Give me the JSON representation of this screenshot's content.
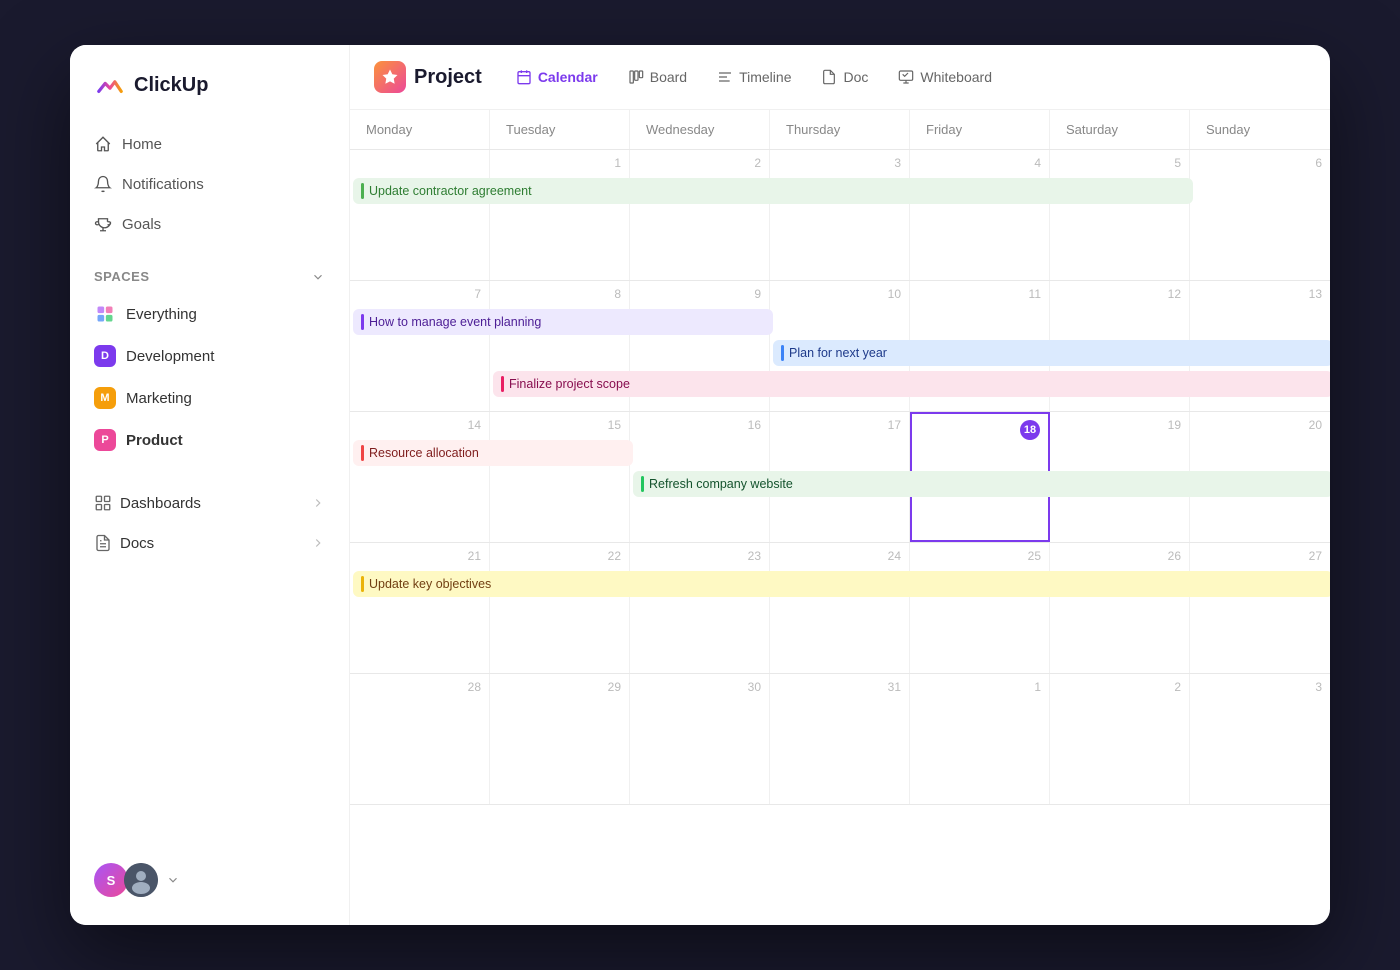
{
  "app": {
    "name": "ClickUp"
  },
  "sidebar": {
    "nav": [
      {
        "id": "home",
        "label": "Home",
        "icon": "home"
      },
      {
        "id": "notifications",
        "label": "Notifications",
        "icon": "bell"
      },
      {
        "id": "goals",
        "label": "Goals",
        "icon": "trophy"
      }
    ],
    "spaces_label": "Spaces",
    "spaces": [
      {
        "id": "everything",
        "label": "Everything",
        "type": "everything",
        "color": null
      },
      {
        "id": "development",
        "label": "Development",
        "type": "dot",
        "color": "#7c3aed",
        "initial": "D"
      },
      {
        "id": "marketing",
        "label": "Marketing",
        "type": "dot",
        "color": "#f59e0b",
        "initial": "M"
      },
      {
        "id": "product",
        "label": "Product",
        "type": "dot",
        "color": "#ec4899",
        "initial": "P",
        "active": true
      }
    ],
    "bottom": [
      {
        "id": "dashboards",
        "label": "Dashboards",
        "has_arrow": true
      },
      {
        "id": "docs",
        "label": "Docs",
        "has_arrow": true
      }
    ],
    "user": {
      "avatar_initial": "S",
      "chevron": "▾"
    }
  },
  "header": {
    "project_icon": "🎯",
    "project_title": "Project",
    "views": [
      {
        "id": "calendar",
        "label": "Calendar",
        "active": true,
        "icon": "calendar"
      },
      {
        "id": "board",
        "label": "Board",
        "active": false,
        "icon": "board"
      },
      {
        "id": "timeline",
        "label": "Timeline",
        "active": false,
        "icon": "timeline"
      },
      {
        "id": "doc",
        "label": "Doc",
        "active": false,
        "icon": "doc"
      },
      {
        "id": "whiteboard",
        "label": "Whiteboard",
        "active": false,
        "icon": "whiteboard"
      }
    ]
  },
  "calendar": {
    "day_headers": [
      "Monday",
      "Tuesday",
      "Wednesday",
      "Thursday",
      "Friday",
      "Saturday",
      "Sunday"
    ],
    "weeks": [
      {
        "cells": [
          {
            "date": "",
            "is_today": false
          },
          {
            "date": "1",
            "is_today": false
          },
          {
            "date": "2",
            "is_today": false
          },
          {
            "date": "3",
            "is_today": false
          },
          {
            "date": "4",
            "is_today": false
          },
          {
            "date": "5",
            "is_today": false
          },
          {
            "date": "6",
            "is_today": false
          }
        ],
        "events": [
          {
            "label": "Update contractor agreement",
            "col_start": 1,
            "col_span": 6,
            "bg": "#e8f5e9",
            "bar": "#4caf50",
            "text": "#2e7d32"
          }
        ]
      },
      {
        "cells": [
          {
            "date": "7",
            "is_today": false
          },
          {
            "date": "8",
            "is_today": false
          },
          {
            "date": "9",
            "is_today": false
          },
          {
            "date": "10",
            "is_today": false
          },
          {
            "date": "11",
            "is_today": false
          },
          {
            "date": "12",
            "is_today": false
          },
          {
            "date": "13",
            "is_today": false
          }
        ],
        "events": [
          {
            "label": "How to manage event planning",
            "col_start": 1,
            "col_span": 3,
            "bg": "#ede9fe",
            "bar": "#7c3aed",
            "text": "#4c1d95"
          },
          {
            "label": "Plan for next year",
            "col_start": 4,
            "col_span": 4,
            "bg": "#dbeafe",
            "bar": "#3b82f6",
            "text": "#1e3a8a"
          },
          {
            "label": "Finalize project scope",
            "col_start": 2,
            "col_span": 6,
            "bg": "#fce4ec",
            "bar": "#e91e63",
            "text": "#880e4f"
          }
        ]
      },
      {
        "cells": [
          {
            "date": "14",
            "is_today": false
          },
          {
            "date": "15",
            "is_today": false
          },
          {
            "date": "16",
            "is_today": false
          },
          {
            "date": "17",
            "is_today": false
          },
          {
            "date": "18",
            "is_today": true
          },
          {
            "date": "19",
            "is_today": false
          },
          {
            "date": "20",
            "is_today": false
          }
        ],
        "events": [
          {
            "label": "Resource allocation",
            "col_start": 1,
            "col_span": 2,
            "bg": "#fff0f0",
            "bar": "#ef4444",
            "text": "#7f1d1d"
          },
          {
            "label": "Refresh company website",
            "col_start": 3,
            "col_span": 5,
            "bg": "#e8f5e9",
            "bar": "#22c55e",
            "text": "#14532d"
          }
        ]
      },
      {
        "cells": [
          {
            "date": "21",
            "is_today": false
          },
          {
            "date": "22",
            "is_today": false
          },
          {
            "date": "23",
            "is_today": false
          },
          {
            "date": "24",
            "is_today": false
          },
          {
            "date": "25",
            "is_today": false
          },
          {
            "date": "26",
            "is_today": false
          },
          {
            "date": "27",
            "is_today": false
          }
        ],
        "events": [
          {
            "label": "Update key objectives",
            "col_start": 1,
            "col_span": 7,
            "bg": "#fef9c3",
            "bar": "#eab308",
            "text": "#713f12"
          }
        ]
      },
      {
        "cells": [
          {
            "date": "28",
            "is_today": false
          },
          {
            "date": "29",
            "is_today": false
          },
          {
            "date": "30",
            "is_today": false
          },
          {
            "date": "31",
            "is_today": false
          },
          {
            "date": "1",
            "is_today": false
          },
          {
            "date": "2",
            "is_today": false
          },
          {
            "date": "3",
            "is_today": false
          }
        ],
        "events": []
      }
    ]
  }
}
